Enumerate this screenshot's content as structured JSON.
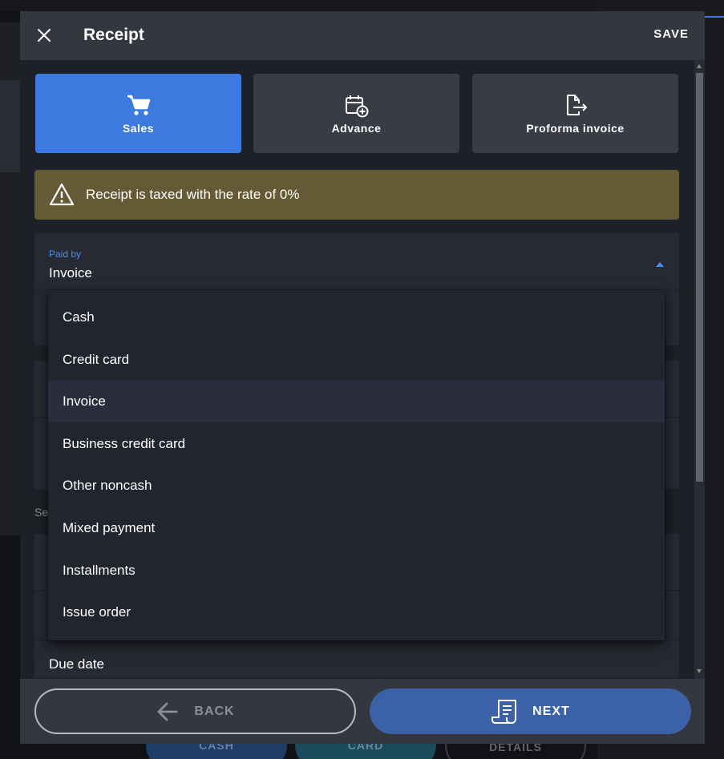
{
  "background": {
    "pills": [
      "CASH",
      "CARD",
      "DETAILS"
    ]
  },
  "modal": {
    "title": "Receipt",
    "save_label": "SAVE"
  },
  "types": [
    {
      "label": "Sales",
      "icon": "cart-icon",
      "active": true
    },
    {
      "label": "Advance",
      "icon": "calendar-plus-icon",
      "active": false
    },
    {
      "label": "Proforma invoice",
      "icon": "document-export-icon",
      "active": false
    }
  ],
  "warning": {
    "icon": "warning-triangle-icon",
    "text": "Receipt is taxed with the rate of 0%"
  },
  "paid_by": {
    "label": "Paid by",
    "value": "Invoice",
    "options": [
      "Cash",
      "Credit card",
      "Invoice",
      "Business credit card",
      "Other noncash",
      "Mixed payment",
      "Installments",
      "Issue order"
    ],
    "selected_index": 2
  },
  "partial_text": "Se",
  "due_date_label": "Due date",
  "footer": {
    "back_label": "BACK",
    "next_label": "NEXT"
  },
  "colors": {
    "accent": "#3d7ae0",
    "next_button": "#3b62a6",
    "warning_bg": "#655a35"
  }
}
